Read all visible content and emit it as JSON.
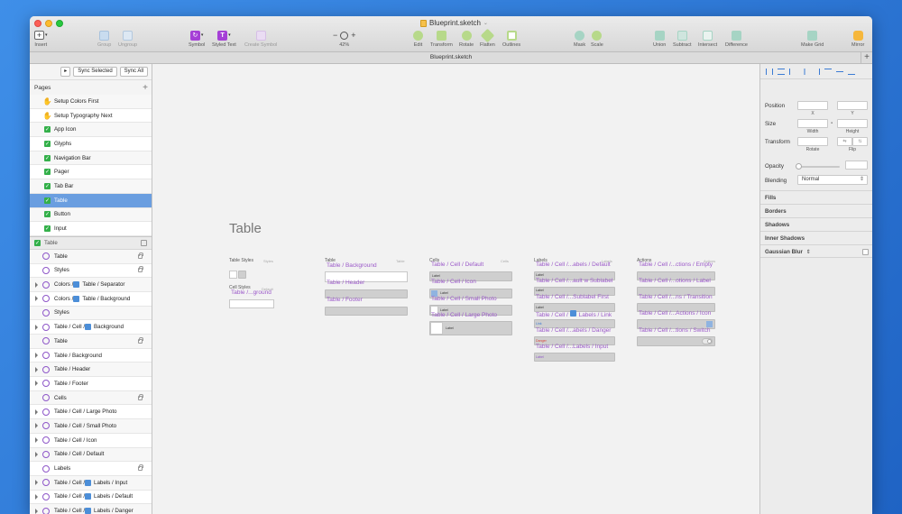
{
  "window": {
    "doc_title": "Blueprint.sketch",
    "tab_title": "Blueprint.sketch"
  },
  "toolbar": {
    "insert": "Insert",
    "group": "Group",
    "ungroup": "Ungroup",
    "symbol": "Symbol",
    "styled_text": "Styled Text",
    "create_symbol": "Create Symbol",
    "zoom_minus": "−",
    "zoom_plus": "+",
    "zoom_level": "42%",
    "edit": "Edit",
    "transform": "Transform",
    "rotate": "Rotate",
    "flatten": "Flatten",
    "outlines": "Outlines",
    "mask": "Mask",
    "scale": "Scale",
    "union": "Union",
    "subtract": "Subtract",
    "intersect": "Intersect",
    "difference": "Difference",
    "make_grid": "Make Grid",
    "mirror": "Mirror"
  },
  "sidebar": {
    "sync_selected": "Sync Selected",
    "sync_all": "Sync All",
    "pages_label": "Pages",
    "pages": [
      {
        "label": "Setup Colors First",
        "icon": "hand"
      },
      {
        "label": "Setup Typography Next",
        "icon": "hand"
      },
      {
        "label": "App Icon",
        "icon": "check"
      },
      {
        "label": "Glyphs",
        "icon": "check"
      },
      {
        "label": "Navigation Bar",
        "icon": "check"
      },
      {
        "label": "Pager",
        "icon": "check"
      },
      {
        "label": "Tab Bar",
        "icon": "check"
      },
      {
        "label": "Table",
        "icon": "check"
      },
      {
        "label": "Button",
        "icon": "check"
      },
      {
        "label": "Input",
        "icon": "check"
      }
    ],
    "layer_group": "Table",
    "layers": [
      {
        "label": "Table",
        "lock": true,
        "expand": false,
        "blue": ""
      },
      {
        "label": "Styles",
        "lock": true,
        "expand": false,
        "blue": ""
      },
      {
        "label": "Colors / ",
        "lock": false,
        "expand": true,
        "blue": "Table / Separator"
      },
      {
        "label": "Colors / ",
        "lock": false,
        "expand": true,
        "blue": "Table / Background"
      },
      {
        "label": "Styles",
        "lock": false,
        "expand": false,
        "blue": ""
      },
      {
        "label": "Table / Cell / ",
        "lock": false,
        "expand": true,
        "blue": "Background"
      },
      {
        "label": "Table",
        "lock": true,
        "expand": false,
        "blue": ""
      },
      {
        "label": "Table / Background",
        "lock": false,
        "expand": true,
        "blue": ""
      },
      {
        "label": "Table / Header",
        "lock": false,
        "expand": true,
        "blue": ""
      },
      {
        "label": "Table / Footer",
        "lock": false,
        "expand": true,
        "blue": ""
      },
      {
        "label": "Cells",
        "lock": true,
        "expand": false,
        "blue": ""
      },
      {
        "label": "Table / Cell / Large Photo",
        "lock": false,
        "expand": true,
        "blue": ""
      },
      {
        "label": "Table / Cell / Small Photo",
        "lock": false,
        "expand": true,
        "blue": ""
      },
      {
        "label": "Table / Cell / Icon",
        "lock": false,
        "expand": true,
        "blue": ""
      },
      {
        "label": "Table / Cell / Default",
        "lock": false,
        "expand": true,
        "blue": ""
      },
      {
        "label": "Labels",
        "lock": true,
        "expand": false,
        "blue": ""
      },
      {
        "label": "Table / Cell / ",
        "lock": false,
        "expand": true,
        "blue": "Labels / Input"
      },
      {
        "label": "Table / Cell / ",
        "lock": false,
        "expand": true,
        "blue": "Labels / Default"
      },
      {
        "label": "Table / Cell / ",
        "lock": false,
        "expand": true,
        "blue": "Labels / Danger"
      }
    ]
  },
  "canvas": {
    "page_heading": "Table",
    "artboards": {
      "table_styles": "Table Styles",
      "cell_styles": "Cell Styles",
      "table": "Table",
      "cells": "Cells",
      "labels": "Labels",
      "actions": "Actions",
      "tag_styles": "Styles",
      "tag_default": "Default",
      "tag_table": "Table",
      "tag_cells": "Cells",
      "tag_labels": "Labels",
      "tag_actions": "Actions"
    },
    "symbols": {
      "cell_bg": "Table /...ground",
      "tbl_bg": "Table / Background",
      "tbl_header": "Table / Header",
      "tbl_footer": "Table / Footer",
      "cell_default": "Table / Cell / Default",
      "cell_icon": "Table / Cell / Icon",
      "cell_small": "Table / Cell / Small Photo",
      "cell_large": "Table / Cell / Large Photo",
      "lab_default": "Table / Cell /...abels / Default",
      "lab_subtle": "Table / Cell /...ault w Sublabel",
      "lab_subfirst": "Table / Cell /...Sublabel First",
      "lab_link_a": "Table / Cell / ",
      "lab_link_b": "Labels / Link",
      "lab_danger": "Table / Cell /...abels / Danger",
      "lab_input": "Table / Cell /...Labels / Input",
      "act_empty": "Table / Cell /...ctions / Empty",
      "act_label": "Table / Cell /...otions / Label",
      "act_trans": "Table / Cell /...ns / Transition",
      "act_icon": "Table / Cell /...Actions / Icon",
      "act_switch": "Table / Cell /...tions / Switch"
    },
    "mini": {
      "label": "Label",
      "link": "Link",
      "danger": "Danger"
    }
  },
  "inspector": {
    "position": "Position",
    "x": "X",
    "y": "Y",
    "size": "Size",
    "width": "Width",
    "height": "Height",
    "transform": "Transform",
    "rotate": "Rotate",
    "flip": "Flip",
    "opacity": "Opacity",
    "blending": "Blending",
    "blending_value": "Normal",
    "fills": "Fills",
    "borders": "Borders",
    "shadows": "Shadows",
    "inner_shadows": "Inner Shadows",
    "gaussian_blur": "Gaussian Blur"
  }
}
